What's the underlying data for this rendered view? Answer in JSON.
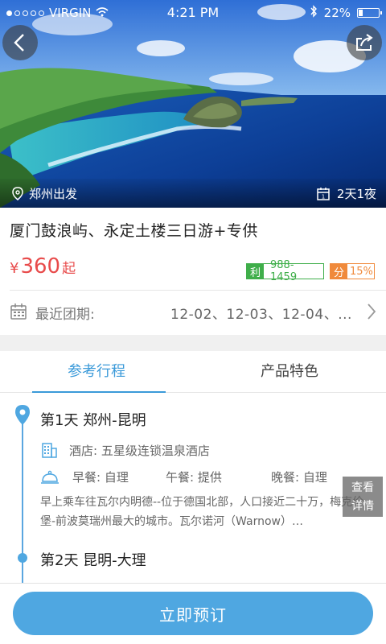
{
  "status_bar": {
    "carrier": "VIRGIN",
    "time": "4:21 PM",
    "battery": "22%",
    "signal_dots_filled": 1,
    "signal_dots_total": 5
  },
  "hero": {
    "departure": "郑州出发",
    "duration": "2天1夜",
    "back_icon": "chevron-left-icon",
    "share_icon": "share-icon"
  },
  "product": {
    "title": "厦门鼓浪屿、永定土楼三日游+专供",
    "price_currency": "¥",
    "price": "360",
    "price_suffix": "起",
    "profit_label": "利",
    "profit_value": "988-1459",
    "share_label": "分",
    "share_value": "15%",
    "dates_label": "最近团期:",
    "dates_values": "12-02、12-03、12-04、..."
  },
  "tabs": [
    {
      "label": "参考行程",
      "active": true
    },
    {
      "label": "产品特色",
      "active": false
    }
  ],
  "itinerary": {
    "day1_title": "第1天   郑州-昆明",
    "hotel": "酒店:  五星级连锁温泉酒店",
    "breakfast": "早餐:  自理",
    "lunch": "午餐:  提供",
    "dinner": "晚餐:  自理",
    "description": "早上乘车往瓦尔内明德--位于德国北部，人口接近二十万，梅克伦堡-前波莫瑞州最大的城市。瓦尔诺河（Warnow）…",
    "day2_title": "第2天   昆明-大理",
    "detail_button": [
      "查看",
      "详情"
    ]
  },
  "actions": {
    "book_label": "立即预订"
  },
  "colors": {
    "accent": "#3b9ad9",
    "price": "#e84b4b",
    "profit": "#3fae4a",
    "share": "#f08a3c",
    "button": "#4fa7e1"
  }
}
